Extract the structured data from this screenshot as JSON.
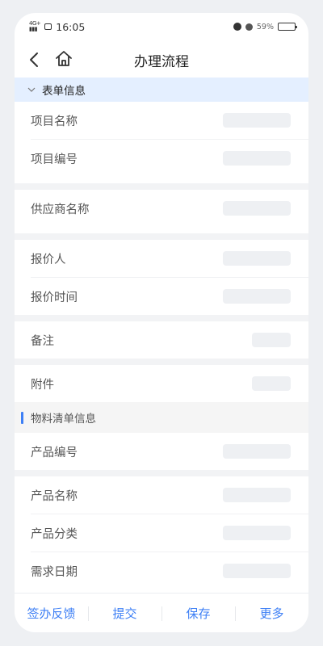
{
  "status_bar": {
    "network": "4G+",
    "time": "16:05",
    "battery_pct": "59%",
    "battery_level": 0.59
  },
  "nav": {
    "title": "办理流程"
  },
  "form_section": {
    "title": "表单信息",
    "fields": [
      {
        "label": "项目名称"
      },
      {
        "label": "项目编号"
      },
      {
        "label": "供应商名称"
      },
      {
        "label": "报价人"
      },
      {
        "label": "报价时间"
      },
      {
        "label": "备注"
      },
      {
        "label": "附件"
      }
    ]
  },
  "material_section": {
    "title": "物料清单信息",
    "fields": [
      {
        "label": "产品编号"
      },
      {
        "label": "产品名称"
      },
      {
        "label": "产品分类"
      },
      {
        "label": "需求日期"
      }
    ]
  },
  "bottom_bar": {
    "actions": [
      "签办反馈",
      "提交",
      "保存",
      "更多"
    ]
  },
  "colors": {
    "accent": "#3d7ff5",
    "section_header_bg": "#e4efff",
    "placeholder_bg": "#eef0f3"
  }
}
